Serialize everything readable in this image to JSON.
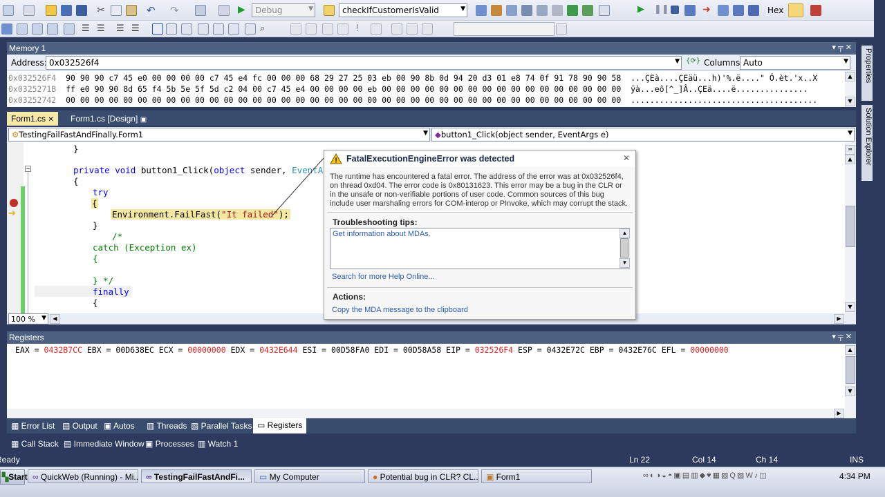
{
  "toolbar": {
    "config": "Debug",
    "function_name": "checkIfCustomerIsValid",
    "hex_label": "Hex"
  },
  "memory": {
    "title": "Memory 1",
    "address_label": "Address:",
    "address_value": "0x032526f4",
    "columns_label": "Columns:",
    "columns_value": "Auto",
    "rows": [
      {
        "addr": "0x032526F4",
        "bytes": "90 90 90 c7 45 e0 00 00 00 00 c7 45 e4 fc 00 00 00 68 29 27 25 03 eb 00 90 8b 0d 94 20 d3 01 e8 74 0f 91 78 90 90 58",
        "text": "...ÇEà....ÇEäü...h)'%.ë....\" Ó.èt.'x..X"
      },
      {
        "addr": "0x0325271B",
        "bytes": "ff e0 90 90 8d 65 f4 5b 5e 5f 5d c2 04 00 c7 45 e4 00 00 00 00 eb 00 00 00 00 00 00 00 00 00 00 00 00 00 00 00 00 00",
        "text": "ÿà...eô[^_]Â..ÇEä....ë..............."
      },
      {
        "addr": "0x03252742",
        "bytes": "00 00 00 00 00 00 00 00 00 00 00 00 00 00 00 00 00 00 00 00 00 00 00 00 00 00 00 00 00 00 00 00 00 00 00 00 00 00 00",
        "text": "......................................."
      }
    ]
  },
  "editor": {
    "tabs": [
      "Form1.cs",
      "Form1.cs [Design]"
    ],
    "class_nav": "TestingFailFastAndFinally.Form1",
    "method_nav": "button1_Click(object sender, EventArgs e)",
    "zoom": "100 %"
  },
  "code": {
    "l1": "}",
    "l2_kw1": "private",
    "l2_kw2": "void",
    "l2_name": " button1_Click(",
    "l2_kw3": "object",
    "l2_mid": " sender, ",
    "l2_ty": "EventArgs",
    "l3": "{",
    "l4": "try",
    "l5": "{",
    "l6_a": "Environment.FailFast(",
    "l6_str": "\"It failed\"",
    "l6_b": ");",
    "l7": "}",
    "l8": "/*",
    "l9": "catch (Exception ex)",
    "l10": "{",
    "l11": "} */",
    "l12": "finally",
    "l13": "{"
  },
  "popup": {
    "title": "FatalExecutionEngineError was detected",
    "body": "The runtime has encountered a fatal error. The address of the error was at 0x032526f4, on thread 0xd04. The error code is 0x80131623. This error may be a bug in the CLR or in the unsafe or non-verifiable portions of user code. Common sources of this bug include user marshaling errors for COM-interop or PInvoke, which may corrupt the stack.",
    "tips_title": "Troubleshooting tips:",
    "tip1": "Get information about MDAs.",
    "help_link": "Search for more Help Online...",
    "actions_title": "Actions:",
    "action1": "Copy the MDA message to the clipboard"
  },
  "registers": {
    "title": "Registers",
    "entries": [
      {
        "name": "EAX",
        "value": "0432B7CC",
        "changed": true
      },
      {
        "name": "EBX",
        "value": "00D638EC",
        "changed": false
      },
      {
        "name": "ECX",
        "value": "00000000",
        "changed": true
      },
      {
        "name": "EDX",
        "value": "0432E644",
        "changed": true
      },
      {
        "name": "ESI",
        "value": "00D58FA0",
        "changed": false
      },
      {
        "name": "EDI",
        "value": "00D58A58",
        "changed": false
      },
      {
        "name": "EIP",
        "value": "032526F4",
        "changed": true
      },
      {
        "name": "ESP",
        "value": "0432E72C",
        "changed": false
      },
      {
        "name": "EBP",
        "value": "0432E76C",
        "changed": false
      },
      {
        "name": "EFL",
        "value": "00000000",
        "changed": true
      }
    ]
  },
  "bottom_tabs1": [
    "Error List",
    "Output",
    "Autos",
    "Threads",
    "Parallel Tasks",
    "Registers"
  ],
  "bottom_tabs2": [
    "Call Stack",
    "Immediate Window",
    "Processes",
    "Watch 1"
  ],
  "side_tabs": [
    "Properties",
    "Solution Explorer"
  ],
  "status": {
    "ready": "Ready",
    "ln": "Ln 22",
    "col": "Col 14",
    "ch": "Ch 14",
    "ins": "INS"
  },
  "taskbar": {
    "start": "Start",
    "items": [
      "QuickWeb (Running) - Mi...",
      "TestingFailFastAndFi...",
      "My Computer",
      "Potential bug in CLR? CL...",
      "Form1"
    ],
    "clock": "4:34 PM"
  }
}
